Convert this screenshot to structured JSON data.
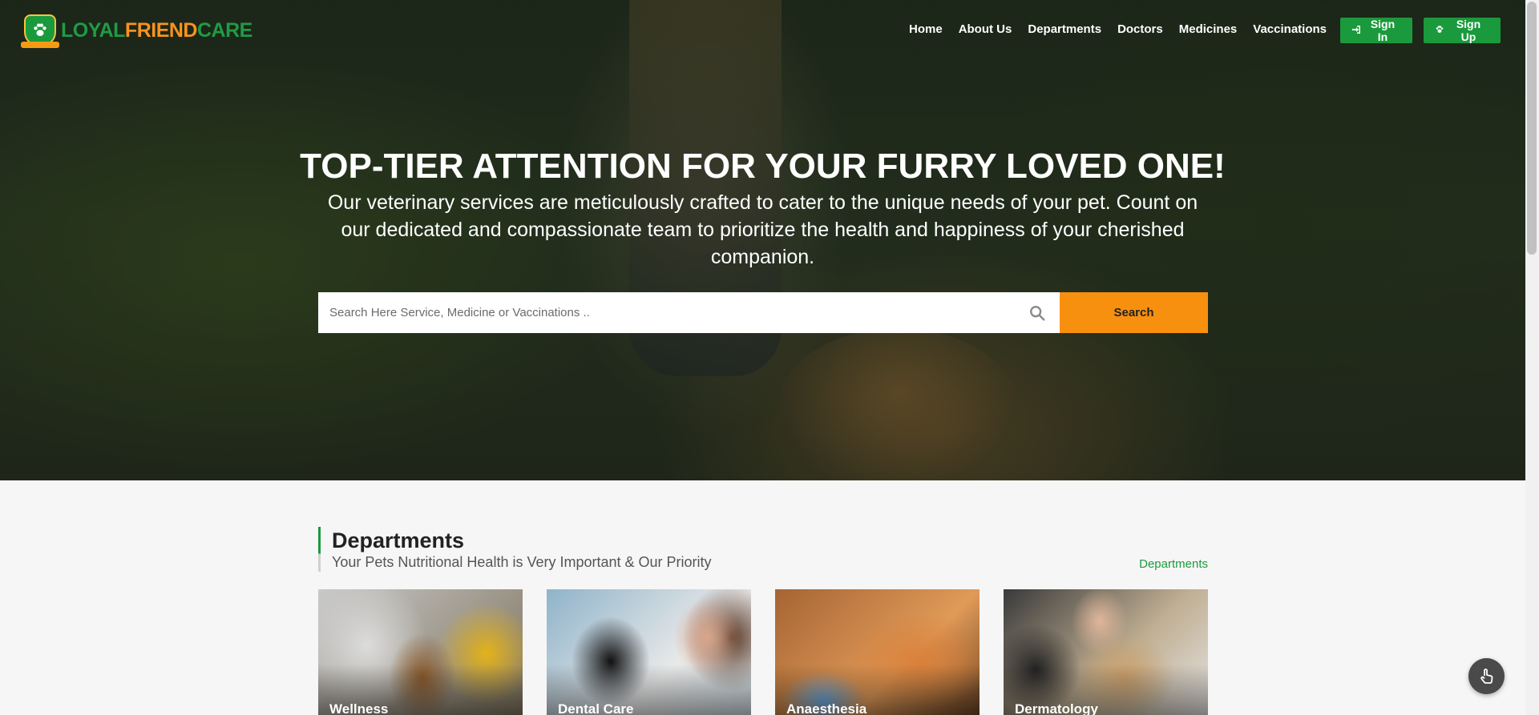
{
  "brand": {
    "logo_part1": "LOYAL",
    "logo_part2": "FRIEND",
    "logo_part3": "CARE",
    "badge_icon": "paw-icon"
  },
  "nav": {
    "items": [
      "Home",
      "About Us",
      "Departments",
      "Doctors",
      "Medicines",
      "Vaccinations"
    ]
  },
  "auth": {
    "signin_label": "Sign In",
    "signin_icon": "sign-in-icon",
    "signup_label": "Sign Up",
    "signup_icon": "paw-icon"
  },
  "hero": {
    "title": "TOP-TIER ATTENTION FOR YOUR FURRY LOVED ONE!",
    "subtitle": "Our veterinary services are meticulously crafted to cater to the unique needs of your pet. Count on our dedicated and compassionate team to prioritize the health and happiness of your cherished companion."
  },
  "search": {
    "placeholder": "Search Here Service, Medicine or Vaccinations ..",
    "value": "",
    "button_label": "Search",
    "icon": "search-icon"
  },
  "departments": {
    "title": "Departments",
    "subtitle": "Your Pets Nutritional Health is Very Important & Our Priority",
    "link_label": "Departments",
    "cards": [
      {
        "label": "Wellness"
      },
      {
        "label": "Dental Care"
      },
      {
        "label": "Anaesthesia"
      },
      {
        "label": "Dermatology"
      }
    ]
  },
  "floating": {
    "icon": "hand-pointer-icon"
  },
  "colors": {
    "brand_green": "#1a9a3c",
    "brand_orange": "#f7900f",
    "page_bg": "#f6f6f6"
  }
}
